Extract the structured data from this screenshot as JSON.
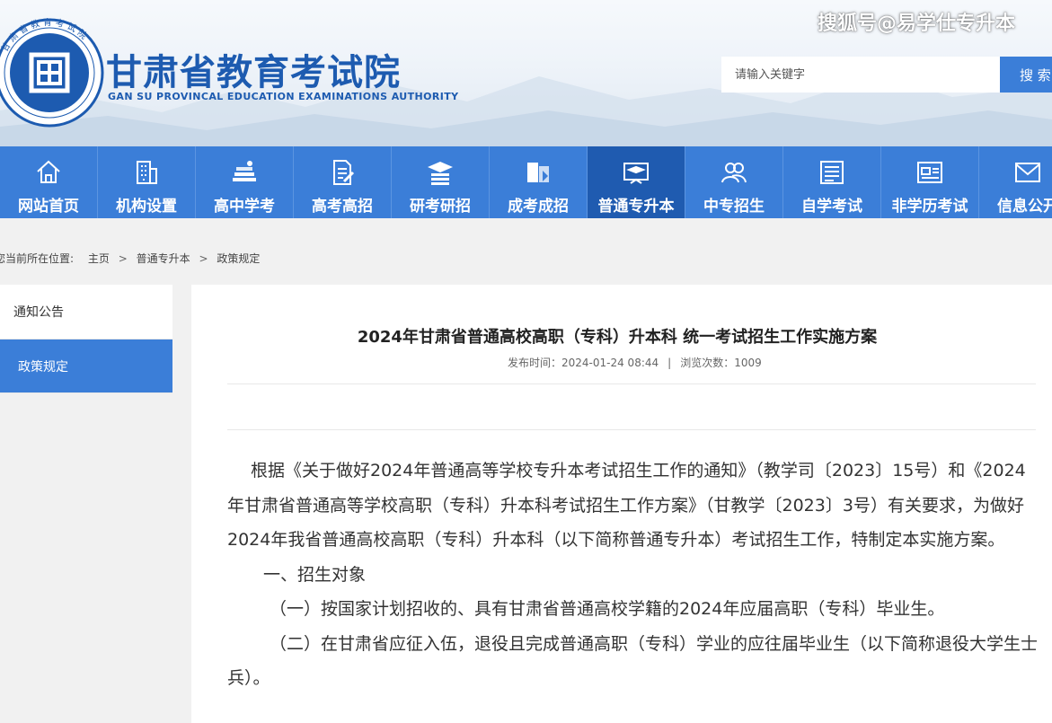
{
  "header": {
    "title": "甘肃省教育考试院",
    "subtitle": "GAN SU PROVINCAL EDUCATION EXAMINATIONS AUTHORITY",
    "logo_char": "囯",
    "logo_ring_text": "甘肃省教育考试院",
    "logo_ring_text_en": "GANSU PROVINCIAL EDUCATION EXAMINATIONS AUTHORITY",
    "watermark": "搜狐号@易学仕专升本",
    "search_placeholder": "请输入关键字",
    "search_button": "搜 索"
  },
  "nav": {
    "items": [
      {
        "label": "网站首页",
        "icon": "home-icon"
      },
      {
        "label": "机构设置",
        "icon": "building-icon"
      },
      {
        "label": "高中学考",
        "icon": "books-icon"
      },
      {
        "label": "高考高招",
        "icon": "document-pen-icon"
      },
      {
        "label": "研考研招",
        "icon": "graduation-cap-icon"
      },
      {
        "label": "成考成招",
        "icon": "book-stack-icon"
      },
      {
        "label": "普通专升本",
        "icon": "board-cap-icon",
        "active": true
      },
      {
        "label": "中专招生",
        "icon": "users-icon"
      },
      {
        "label": "自学考试",
        "icon": "list-window-icon"
      },
      {
        "label": "非学历考试",
        "icon": "id-card-icon"
      },
      {
        "label": "信息公开",
        "icon": "mail-icon"
      }
    ]
  },
  "breadcrumb": {
    "prefix": "您当前所在位置:",
    "items": [
      "主页",
      "普通专升本",
      "政策规定"
    ],
    "separator": ">"
  },
  "sidebar": {
    "items": [
      {
        "label": "通知公告"
      },
      {
        "label": "政策规定",
        "active": true
      }
    ]
  },
  "article": {
    "title": "2024年甘肃省普通高校高职（专科）升本科 统一考试招生工作实施方案",
    "publish_label": "发布时间：2024-01-24 08:44",
    "views_label": "浏览次数：1009",
    "meta_separator": "|",
    "paragraphs": [
      "根据《关于做好2024年普通高等学校专升本考试招生工作的通知》（教学司〔2023〕15号）和《2024年甘肃省普通高等学校高职（专科）升本科考试招生工作方案》（甘教学〔2023〕3号）有关要求，为做好2024年我省普通高校高职（专科）升本科（以下简称普通专升本）考试招生工作，特制定本实施方案。",
      "一、招生对象",
      "（一）按国家计划招收的、具有甘肃省普通高校学籍的2024年应届高职（专科）毕业生。",
      "（二）在甘肃省应征入伍，退役且完成普通高职（专科）学业的应往届毕业生（以下简称退役大学生士兵）。"
    ]
  },
  "colors": {
    "primary": "#3b7ed8",
    "nav_active": "#1f5bb0",
    "brand_text": "#1d5bb0"
  }
}
